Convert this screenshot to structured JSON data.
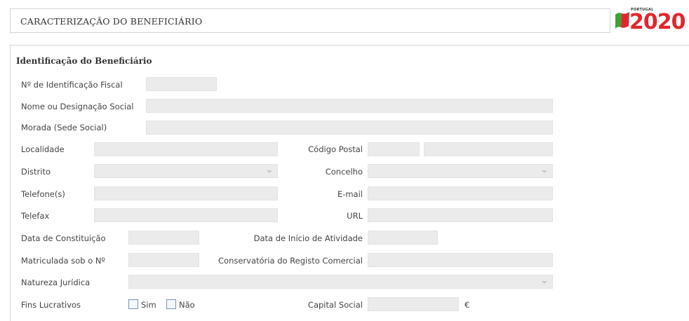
{
  "header": {
    "title": "CARACTERIZAÇÃO DO BENEFICIÁRIO",
    "logo_small": "PORTUGAL",
    "logo_year": "2020"
  },
  "section": {
    "title": "Identificação do Beneficiário"
  },
  "fields": {
    "nif": {
      "label": "Nº de Identificação Fiscal",
      "value": ""
    },
    "nome": {
      "label": "Nome ou Designação Social",
      "value": ""
    },
    "morada": {
      "label": "Morada (Sede Social)",
      "value": ""
    },
    "localidade": {
      "label": "Localidade",
      "value": ""
    },
    "codigo_postal": {
      "label": "Código Postal",
      "value": ""
    },
    "distrito": {
      "label": "Distrito",
      "value": ""
    },
    "concelho": {
      "label": "Concelho",
      "value": ""
    },
    "telefone": {
      "label": "Telefone(s)",
      "value": ""
    },
    "email": {
      "label": "E-mail",
      "value": ""
    },
    "telefax": {
      "label": "Telefax",
      "value": ""
    },
    "url": {
      "label": "URL",
      "value": ""
    },
    "data_constituicao": {
      "label": "Data de Constituição",
      "value": ""
    },
    "data_inicio": {
      "label": "Data de Início de Atividade",
      "value": ""
    },
    "matriculada": {
      "label": "Matriculada sob o Nº",
      "value": ""
    },
    "conservatoria": {
      "label": "Conservatória do Registo Comercial",
      "value": ""
    },
    "natureza": {
      "label": "Natureza Jurídica",
      "value": ""
    },
    "fins": {
      "label": "Fins Lucrativos",
      "sim": "Sim",
      "nao": "Não"
    },
    "capital": {
      "label": "Capital Social",
      "currency": "€",
      "value": ""
    }
  },
  "colors": {
    "field_bg": "#ebebeb",
    "logo_red": "#e3262c",
    "logo_green": "#3aa335"
  }
}
